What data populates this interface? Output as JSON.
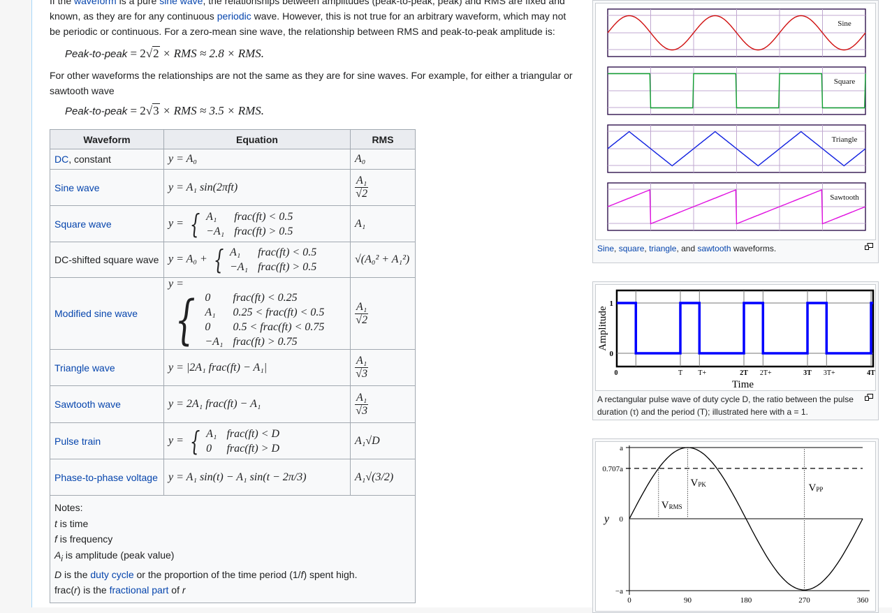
{
  "article": {
    "para1": {
      "pre": "If the ",
      "link1": "waveform",
      "mid1": " is a pure ",
      "link2": "sine wave",
      "post1": ", the relationships between amplitudes (peak-to-peak, peak) and RMS are fixed and known, as they are for any continuous ",
      "link3": "periodic",
      "post2": " wave. However, this is not true for an arbitrary waveform, which may not be periodic or continuous. For a zero-mean sine wave, the relationship between RMS and peak-to-peak amplitude is:"
    },
    "eq1": {
      "label": "Peak-to-peak",
      "expr_a": " = 2",
      "root": "2",
      "expr_b": " × RMS ≈ 2.8 × RMS."
    },
    "para2": "For other waveforms the relationships are not the same as they are for sine waves. For example, for either a triangular or sawtooth wave",
    "eq2": {
      "label": "Peak-to-peak",
      "expr_a": " = 2",
      "root": "3",
      "expr_b": " × RMS ≈ 3.5 × RMS."
    }
  },
  "table": {
    "headers": [
      "Waveform",
      "Equation",
      "RMS"
    ],
    "rows": [
      {
        "waveform_link": "DC",
        "waveform_suffix": ", constant",
        "equation": "y = A₀",
        "rms": "A₀"
      },
      {
        "waveform_link": "Sine wave",
        "equation": "y = A₁ sin(2πft)",
        "rms_num": "A₁",
        "rms_den": "√2"
      },
      {
        "waveform_link": "Square wave",
        "equation_prefix": "y =",
        "cases": [
          [
            "A₁",
            "frac(ft) < 0.5"
          ],
          [
            "−A₁",
            "frac(ft) > 0.5"
          ]
        ],
        "rms": "A₁"
      },
      {
        "waveform_text": "DC-shifted square wave",
        "equation_prefix": "y = A₀ +",
        "cases": [
          [
            "A₁",
            "frac(ft) < 0.5"
          ],
          [
            "−A₁",
            "frac(ft) > 0.5"
          ]
        ],
        "rms": "√(A₀² + A₁²)"
      },
      {
        "waveform_link": "Modified sine wave",
        "equation_prefix": "y =",
        "cases": [
          [
            "0",
            "frac(ft) < 0.25"
          ],
          [
            "A₁",
            "0.25 < frac(ft) < 0.5"
          ],
          [
            "0",
            "0.5 < frac(ft) < 0.75"
          ],
          [
            "−A₁",
            "frac(ft) > 0.75"
          ]
        ],
        "rms_num": "A₁",
        "rms_den": "√2"
      },
      {
        "waveform_link": "Triangle wave",
        "equation": "y = |2A₁ frac(ft) − A₁|",
        "rms_num": "A₁",
        "rms_den": "√3"
      },
      {
        "waveform_link": "Sawtooth wave",
        "equation": "y = 2A₁ frac(ft) − A₁",
        "rms_num": "A₁",
        "rms_den": "√3"
      },
      {
        "waveform_link": "Pulse train",
        "equation_prefix": "y =",
        "cases": [
          [
            "A₁",
            "frac(ft) < D"
          ],
          [
            "0",
            "frac(ft) > D"
          ]
        ],
        "rms": "A₁√D"
      },
      {
        "waveform_link": "Phase-to-phase voltage",
        "equation": "y = A₁ sin(t) − A₁ sin(t − 2π/3)",
        "rms": "A₁√(3/2)"
      }
    ],
    "notes": {
      "title": "Notes:",
      "t": {
        "var": "t",
        "text": " is time"
      },
      "f": {
        "var": "f",
        "text": " is frequency"
      },
      "a": {
        "var": "A",
        "sub": "i",
        "text": " is amplitude (peak value)"
      },
      "d": {
        "var": "D",
        "pre": " is the ",
        "link": "duty cycle",
        "post": " or the proportion of the time period (1/",
        "var2": "f",
        "post2": ") spent high."
      },
      "frac": {
        "pre": "frac(",
        "var": "r",
        "mid": ") is the ",
        "link": "fractional part",
        "post": " of ",
        "var2": "r"
      }
    }
  },
  "figures": {
    "waveforms": {
      "panels": [
        "Sine",
        "Square",
        "Triangle",
        "Sawtooth"
      ],
      "colors": {
        "sine": "#d01010",
        "square": "#10a030",
        "triangle": "#1020e0",
        "sawtooth": "#e010e0",
        "grid": "#c0a8d0",
        "frame": "#200040"
      },
      "caption": {
        "l1": "Sine",
        "s1": ", ",
        "l2": "square",
        "s2": ", ",
        "l3": "triangle",
        "s3": ", and ",
        "l4": "sawtooth",
        "s4": " waveforms."
      }
    },
    "pulse": {
      "y_axis_label": "Amplitude",
      "x_axis_label": "Time",
      "y_ticks": [
        "1",
        "0"
      ],
      "x_ticks": [
        "0",
        "T",
        "T+",
        "2T",
        "2T+",
        "3T",
        "3T+",
        "4T"
      ],
      "duty_cycle": 0.3,
      "color": "#0000ff",
      "caption": "A rectangular pulse wave of duty cycle D, the ratio between the pulse duration (τ) and the period (T); illustrated here with a = 1."
    },
    "rms_sine": {
      "y_label": "y",
      "y_ticks": [
        "a",
        "0.707a",
        "0",
        "−a"
      ],
      "x_ticks": [
        "0",
        "90",
        "180",
        "270",
        "360"
      ],
      "labels": {
        "vpk": "V",
        "vpk_sub": "PK",
        "vrms": "V",
        "vrms_sub": "RMS",
        "vpp": "V",
        "vpp_sub": "PP"
      }
    }
  }
}
